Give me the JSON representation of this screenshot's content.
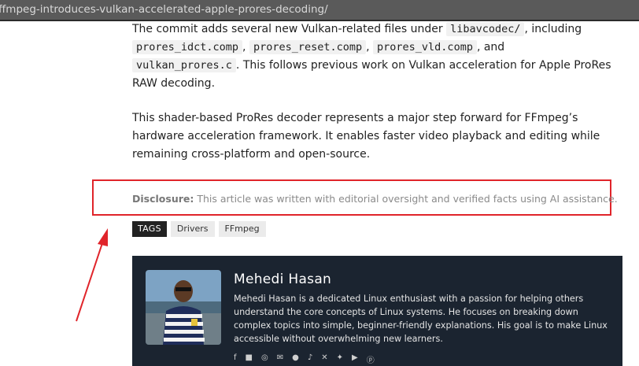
{
  "status_url": "ffmpeg-introduces-vulkan-accelerated-apple-prores-decoding/",
  "article": {
    "p1_intro": "The commit adds several new Vulkan-related files under ",
    "p1_path": "libavcodec/",
    "p1_including": ", including",
    "file1": "prores_idct.comp",
    "sep1": ",",
    "file2": "prores_reset.comp",
    "sep2": ",",
    "file3": "prores_vld.comp",
    "and": ", and",
    "file4": "vulkan_prores.c",
    "p1_end": ". This follows previous work on Vulkan acceleration for Apple ProRes RAW decoding.",
    "p2": "This shader-based ProRes decoder represents a major step forward for FFmpeg’s hardware acceleration framework. It enables faster video playback and editing while remaining cross-platform and open-source."
  },
  "disclosure": {
    "label": "Disclosure:",
    "text": " This article was written with editorial oversight and verified facts using AI assistance."
  },
  "tags": {
    "heading": "TAGS",
    "items": [
      "Drivers",
      "FFmpeg"
    ]
  },
  "author": {
    "name": "Mehedi Hasan",
    "bio": "Mehedi Hasan is a dedicated Linux enthusiast with a passion for helping others understand the core concepts of Linux systems. He focuses on breaking down complex topics into simple, beginner-friendly explanations. His goal is to make Linux accessible without overwhelming new learners.",
    "social_icons": [
      "facebook-icon",
      "linkedin-icon",
      "instagram-icon",
      "email-icon",
      "github-icon",
      "tiktok-icon",
      "x-icon",
      "twitter-icon",
      "youtube-icon",
      "pinterest-icon"
    ]
  },
  "colors": {
    "highlight_box": "#e0242a",
    "arrow": "#e0242a",
    "author_bg": "#1b2430"
  }
}
